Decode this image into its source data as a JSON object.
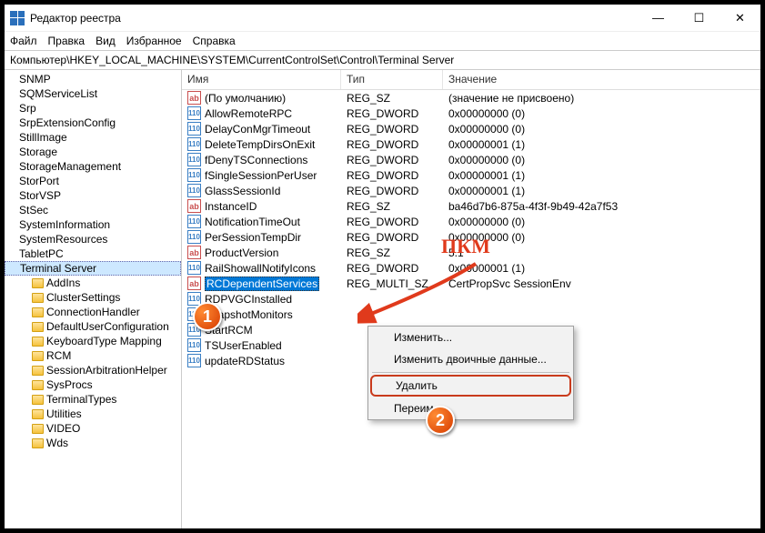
{
  "window": {
    "title": "Редактор реестра"
  },
  "menu": {
    "file": "Файл",
    "edit": "Правка",
    "view": "Вид",
    "fav": "Избранное",
    "help": "Справка"
  },
  "address": "Компьютер\\HKEY_LOCAL_MACHINE\\SYSTEM\\CurrentControlSet\\Control\\Terminal Server",
  "tree": {
    "items": [
      "SNMP",
      "SQMServiceList",
      "Srp",
      "SrpExtensionConfig",
      "StillImage",
      "Storage",
      "StorageManagement",
      "StorPort",
      "StorVSP",
      "StSec",
      "SystemInformation",
      "SystemResources",
      "TabletPC",
      "Terminal Server"
    ],
    "subs": [
      "AddIns",
      "ClusterSettings",
      "ConnectionHandler",
      "DefaultUserConfiguration",
      "KeyboardType Mapping",
      "RCM",
      "SessionArbitrationHelper",
      "SysProcs",
      "TerminalTypes",
      "Utilities",
      "VIDEO",
      "Wds"
    ]
  },
  "cols": {
    "name": "Имя",
    "type": "Тип",
    "val": "Значение"
  },
  "rows": [
    {
      "ico": "str",
      "name": "(По умолчанию)",
      "type": "REG_SZ",
      "val": "(значение не присвоено)"
    },
    {
      "ico": "dw",
      "name": "AllowRemoteRPC",
      "type": "REG_DWORD",
      "val": "0x00000000 (0)"
    },
    {
      "ico": "dw",
      "name": "DelayConMgrTimeout",
      "type": "REG_DWORD",
      "val": "0x00000000 (0)"
    },
    {
      "ico": "dw",
      "name": "DeleteTempDirsOnExit",
      "type": "REG_DWORD",
      "val": "0x00000001 (1)"
    },
    {
      "ico": "dw",
      "name": "fDenyTSConnections",
      "type": "REG_DWORD",
      "val": "0x00000000 (0)"
    },
    {
      "ico": "dw",
      "name": "fSingleSessionPerUser",
      "type": "REG_DWORD",
      "val": "0x00000001 (1)"
    },
    {
      "ico": "dw",
      "name": "GlassSessionId",
      "type": "REG_DWORD",
      "val": "0x00000001 (1)"
    },
    {
      "ico": "str",
      "name": "InstanceID",
      "type": "REG_SZ",
      "val": "ba46d7b6-875a-4f3f-9b49-42a7f53"
    },
    {
      "ico": "dw",
      "name": "NotificationTimeOut",
      "type": "REG_DWORD",
      "val": "0x00000000 (0)"
    },
    {
      "ico": "dw",
      "name": "PerSessionTempDir",
      "type": "REG_DWORD",
      "val": "0x00000000 (0)"
    },
    {
      "ico": "str",
      "name": "ProductVersion",
      "type": "REG_SZ",
      "val": "5.1"
    },
    {
      "ico": "dw",
      "name": "RailShowallNotifyIcons",
      "type": "REG_DWORD",
      "val": "0x00000001 (1)"
    },
    {
      "ico": "str",
      "name": "RCDependentServices",
      "type": "REG_MULTI_SZ",
      "val": "CertPropSvc SessionEnv",
      "sel": true
    },
    {
      "ico": "dw",
      "name": "RDPVGCInstalled",
      "type": "",
      "val": ""
    },
    {
      "ico": "dw",
      "name": "SnapshotMonitors",
      "type": "",
      "val": ""
    },
    {
      "ico": "dw",
      "name": "StartRCM",
      "type": "",
      "val": ""
    },
    {
      "ico": "dw",
      "name": "TSUserEnabled",
      "type": "",
      "val": ""
    },
    {
      "ico": "dw",
      "name": "updateRDStatus",
      "type": "",
      "val": ""
    }
  ],
  "ctx": {
    "modify": "Изменить...",
    "modbin": "Изменить двоичные данные...",
    "delete": "Удалить",
    "rename": "Переим"
  },
  "annot": {
    "pkm": "ПКМ",
    "b1": "1",
    "b2": "2"
  }
}
